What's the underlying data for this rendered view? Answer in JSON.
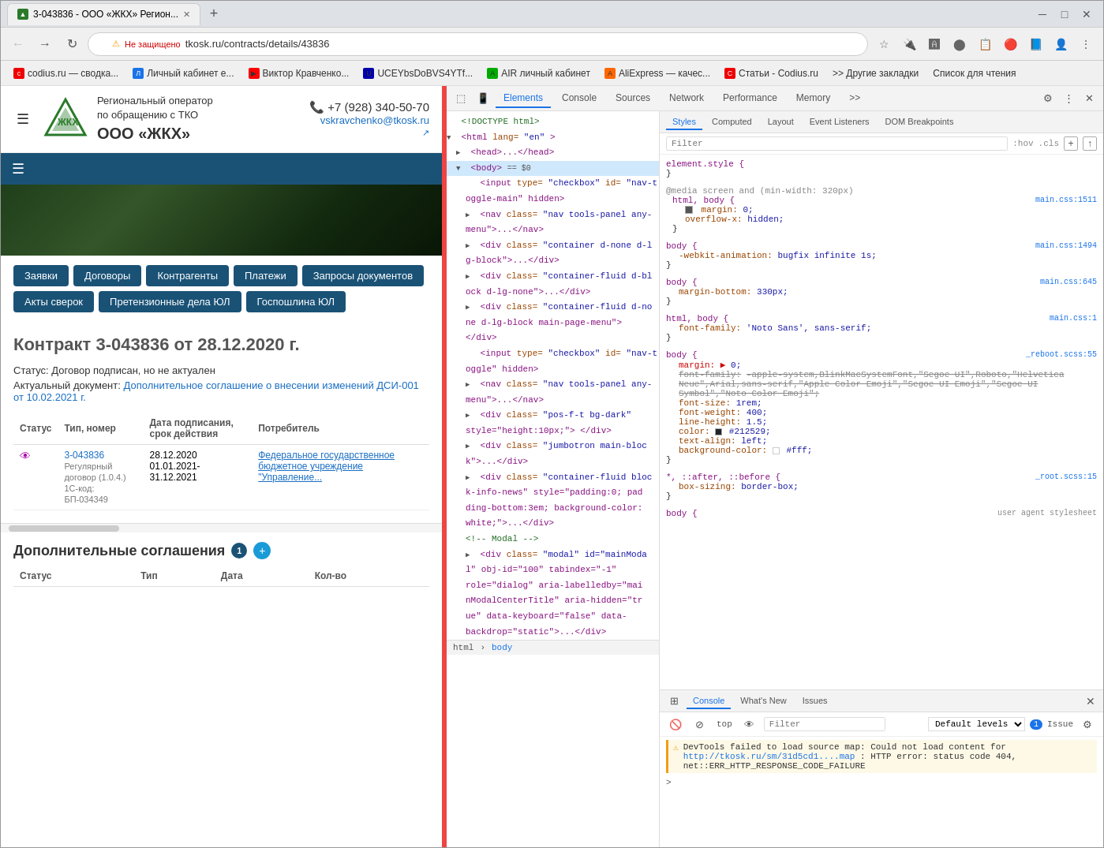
{
  "browser": {
    "title": "3-043836 - ООО «ЖКХ» Регион...",
    "tab_favicon": "▲",
    "new_tab_icon": "+",
    "address_bar": {
      "security_label": "Не защищено",
      "url": "tkosk.ru/contracts/details/43836",
      "lock_icon": "⚠"
    },
    "window_controls": {
      "minimize": "─",
      "maximize": "□",
      "close": "✕"
    }
  },
  "bookmarks": [
    {
      "label": "codius.ru — сводка...",
      "icon": "📄"
    },
    {
      "label": "Личный кабинет е...",
      "icon": "🔵"
    },
    {
      "label": "Виктор Кравченко...",
      "icon": "▶"
    },
    {
      "label": "UCEYbsDoBVS4YТf...",
      "icon": "📊"
    },
    {
      "label": "AIR личный кабинет",
      "icon": "✈"
    },
    {
      "label": "AliExpress — качес...",
      "icon": "🛒"
    },
    {
      "label": "Статьи - Codius.ru",
      "icon": "📰"
    },
    {
      "label": ">> Другие закладки",
      "icon": ""
    },
    {
      "label": "Список для чтения",
      "icon": ""
    }
  ],
  "website": {
    "company_short": "Региональный оператор",
    "company_line2": "по обращению с ТКО",
    "company_name": "ООО «ЖКХ»",
    "phone": "+7 (928) 340-50-70",
    "email": "vskravchenko@tkosk.ru",
    "nav_items": [
      "Заявки",
      "Договоры",
      "Контрагенты",
      "Платежи",
      "Запросы документов",
      "Акты сверок",
      "Претензионные дела ЮЛ",
      "Госпошлина ЮЛ"
    ],
    "contract_title": "Контракт 3-043836 от 28.12.2020 г.",
    "status_label": "Статус:",
    "status_value": "Договор подписан, но не актуален",
    "actual_doc_label": "Актуальный документ:",
    "actual_doc_link": "Дополнительное соглашение о внесении изменений ДСИ-001 от 10.02.2021 г.",
    "table_headers": [
      "Статус",
      "Тип, номер",
      "Дата подписания, срок действия",
      "Потребитель"
    ],
    "table_row": {
      "status_icon": "👁",
      "contract_link": "3-043836",
      "contract_sub1": "Регулярный договор (1.0.4.)",
      "contract_sub2": "1С-код: БП-034349",
      "date1": "28.12.2020",
      "date2": "01.01.2021-31.12.2021",
      "consumer": "Федеральное государственное бюджетное учреждение \"Управление..."
    },
    "add_agreements_title": "Дополнительные соглашения",
    "add_count": "1",
    "add_table_headers": [
      "Статус",
      "Тип",
      "Дата",
      "Кол-во"
    ]
  },
  "devtools": {
    "tabs": [
      "Elements",
      "Console",
      "Sources",
      "Network",
      "Performance",
      "Memory",
      ">>"
    ],
    "active_tab": "Elements",
    "styles_tabs": [
      "Styles",
      "Computed",
      "Layout",
      "Event Listeners",
      "DOM Breakpoints"
    ],
    "active_styles_tab": "Styles",
    "filter_placeholder": "Filter",
    "filter_hints": [
      ":hov",
      ".cls",
      "+",
      "↑"
    ],
    "dom": {
      "lines": [
        {
          "indent": 0,
          "content": "<!DOCTYPE html>",
          "type": "comment"
        },
        {
          "indent": 0,
          "content": "<html lang=\"en\">",
          "type": "tag",
          "arrow": "down"
        },
        {
          "indent": 1,
          "content": "<head>...</head>",
          "type": "tag",
          "arrow": "right"
        },
        {
          "indent": 1,
          "content": "<body> == $0",
          "type": "tag",
          "arrow": "down",
          "selected": true
        },
        {
          "indent": 2,
          "content": "<input type=\"checkbox\" id=\"nav-t",
          "type": "tag"
        },
        {
          "indent": 2,
          "content": "oggle-main\" hidden>",
          "type": "tag"
        },
        {
          "indent": 2,
          "content": "<nav class=\"nav tools-panel any-",
          "type": "tag",
          "arrow": "right"
        },
        {
          "indent": 2,
          "content": "menu\">...</nav>",
          "type": "tag"
        },
        {
          "indent": 2,
          "content": "<div class=\"container d-none d-l",
          "type": "tag",
          "arrow": "right"
        },
        {
          "indent": 2,
          "content": "g-block\">...</div>",
          "type": "tag"
        },
        {
          "indent": 2,
          "content": "<div class=\"container-fluid d-bl",
          "type": "tag",
          "arrow": "right"
        },
        {
          "indent": 2,
          "content": "ock d-lg-none\">...</div>",
          "type": "tag"
        },
        {
          "indent": 2,
          "content": "<div class=\"container-fluid d-no",
          "type": "tag",
          "arrow": "right"
        },
        {
          "indent": 2,
          "content": "ne d-lg-block main-page-menu\">",
          "type": "tag"
        },
        {
          "indent": 2,
          "content": "</div>",
          "type": "tag"
        },
        {
          "indent": 2,
          "content": "<input type=\"checkbox\" id=\"nav-t",
          "type": "tag"
        },
        {
          "indent": 2,
          "content": "oggle\" hidden>",
          "type": "tag"
        },
        {
          "indent": 2,
          "content": "<nav class=\"nav tools-panel any-",
          "type": "tag",
          "arrow": "right"
        },
        {
          "indent": 2,
          "content": "menu\">...</nav>",
          "type": "tag"
        },
        {
          "indent": 2,
          "content": "<div class=\"pos-f-t bg-dark\"",
          "type": "tag",
          "arrow": "right"
        },
        {
          "indent": 2,
          "content": "style=\"height:10px;\"> </div>",
          "type": "tag"
        },
        {
          "indent": 2,
          "content": "<div class=\"jumbotron main-bloc",
          "type": "tag",
          "arrow": "right"
        },
        {
          "indent": 2,
          "content": "k\">...</div>",
          "type": "tag"
        },
        {
          "indent": 2,
          "content": "<div class=\"container-fluid bloc",
          "type": "tag",
          "arrow": "right"
        },
        {
          "indent": 2,
          "content": "k-info-news\" style=\"padding:0; pad",
          "type": "tag"
        },
        {
          "indent": 2,
          "content": "ding-bottom:3em; background-color:",
          "type": "tag"
        },
        {
          "indent": 2,
          "content": "white;\">...</div>",
          "type": "tag"
        },
        {
          "indent": 2,
          "content": "<!-- Modal -->",
          "type": "comment"
        },
        {
          "indent": 2,
          "content": "<div class=\"modal\" id=\"mainModa",
          "type": "tag",
          "arrow": "right"
        },
        {
          "indent": 2,
          "content": "l\" obj-id=\"100\" tabindex=\"-1\"",
          "type": "tag"
        },
        {
          "indent": 2,
          "content": "role=\"dialog\" aria-labelledby=\"mai",
          "type": "tag"
        },
        {
          "indent": 2,
          "content": "nModalCenterTitle\" aria-hidden=\"tr",
          "type": "tag"
        },
        {
          "indent": 2,
          "content": "ue\" data-keyboard=\"false\" data-",
          "type": "tag"
        },
        {
          "indent": 2,
          "content": "backdrop=\"static\">...</div>",
          "type": "tag"
        }
      ]
    },
    "dom_breadcrumb": [
      "html",
      "body"
    ],
    "styles": {
      "rules": [
        {
          "selector": "element.style {",
          "source": "",
          "properties": []
        },
        {
          "selector": "@media screen and (min-width: 320px)",
          "source": "",
          "properties": [],
          "nested": {
            "selector": "html, body {",
            "source": "main.css:1511",
            "properties": [
              {
                "name": "margin:",
                "value": "0;",
                "checkbox": true,
                "strikethrough": false
              },
              {
                "name": "overflow-x:",
                "value": "hidden;",
                "checkbox": false,
                "strikethrough": false
              }
            ]
          }
        },
        {
          "selector": "body {",
          "source": "main.css:1494",
          "properties": [
            {
              "name": "-webkit-animation:",
              "value": "bugfix infinite 1s;",
              "checkbox": false,
              "strikethrough": false
            }
          ]
        },
        {
          "selector": "body {",
          "source": "main.css:645",
          "properties": [
            {
              "name": "margin-bottom:",
              "value": "330px;",
              "checkbox": false,
              "strikethrough": false
            }
          ]
        },
        {
          "selector": "html, body {",
          "source": "main.css:1",
          "properties": [
            {
              "name": "font-family:",
              "value": "'Noto Sans', sans-serif;",
              "checkbox": false,
              "strikethrough": false
            }
          ]
        },
        {
          "selector": "body {",
          "source": "_reboot.scss:55",
          "properties": [
            {
              "name": "margin:",
              "value": "0;",
              "checkbox": false,
              "strikethrough": false
            },
            {
              "name": "font-family:",
              "value": "-apple-system,BlinkMacSystemFont,\"Segoe UI\",Roboto,\"Helvetica Neue\",Arial,sans-serif,\"Apple Color Emoji\",\"Segoe UI Emoji\",\"Segoe UI Symbol\",\"Noto Color Emoji\";",
              "checkbox": false,
              "strikethrough": true
            },
            {
              "name": "font-size:",
              "value": "1rem;",
              "checkbox": false,
              "strikethrough": false
            },
            {
              "name": "font-weight:",
              "value": "400;",
              "checkbox": false,
              "strikethrough": false
            },
            {
              "name": "line-height:",
              "value": "1.5;",
              "checkbox": false,
              "strikethrough": false
            },
            {
              "name": "color:",
              "value": "#212529;",
              "checkbox": false,
              "strikethrough": false,
              "swatch": "#212529"
            },
            {
              "name": "text-align:",
              "value": "left;",
              "checkbox": false,
              "strikethrough": false
            },
            {
              "name": "background-color:",
              "value": "#fff;",
              "checkbox": false,
              "strikethrough": false,
              "swatch": "#fff"
            }
          ]
        },
        {
          "selector": "*, ::after, ::before {",
          "source": "_root.scss:15",
          "properties": [
            {
              "name": "box-sizing:",
              "value": "border-box;",
              "checkbox": false,
              "strikethrough": false
            }
          ]
        },
        {
          "selector": "body {",
          "source": "user agent stylesheet",
          "properties": []
        }
      ]
    },
    "console": {
      "tabs": [
        "Console",
        "What's New",
        "Issues"
      ],
      "active_tab": "Console",
      "top_label": "top",
      "filter_placeholder": "Filter",
      "level_label": "Default levels",
      "issue_count": "1",
      "warning_text": "DevTools failed to load source map: Could not load content for ",
      "warning_link": "http://tkosk.ru/sm/31d5cd1....map",
      "warning_suffix": ": HTTP error: status code 404, net::ERR_HTTP_RESPONSE_CODE_FAILURE",
      "issue_badge": "1"
    }
  }
}
